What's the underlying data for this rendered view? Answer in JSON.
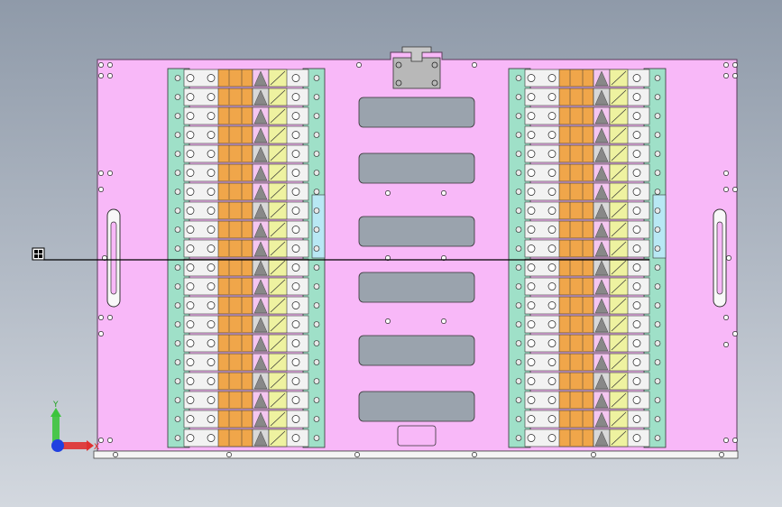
{
  "view": {
    "background_top": "#8f9aa9",
    "background_bottom": "#d3d8df"
  },
  "colors": {
    "plate": "#f8b8f8",
    "plate_edge": "#5a3a5a",
    "rail_teal": "#9fe0c8",
    "rail_cyan": "#b8e8f4",
    "terminal_orange": "#f0a64a",
    "terminal_grey": "#d8d8d8",
    "terminal_pink": "#f4c6f0",
    "terminal_yellow": "#eef2a0",
    "slot": "#9aa3ad",
    "bracket": "#b8b8b8",
    "line": "#000000",
    "axis_x": "#e02020",
    "axis_y": "#20b020",
    "axis_z": "#2040e0"
  },
  "modules": {
    "count": 2,
    "terminals_per_module": 20
  },
  "slots": {
    "count": 6
  },
  "axis_triad": {
    "x_label": "X",
    "y_label": "Y",
    "icon": "coordinate-triad-icon"
  },
  "origin_marker": {
    "icon": "origin-marker-icon"
  }
}
